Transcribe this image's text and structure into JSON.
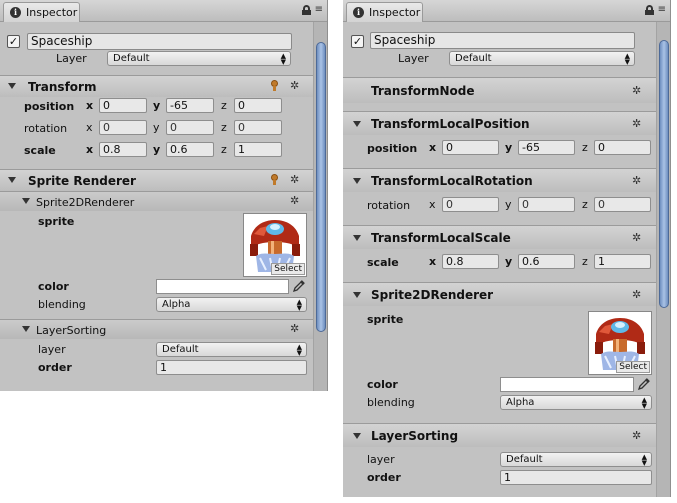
{
  "inspector_tab": "Inspector",
  "gameobject": {
    "name": "Spaceship",
    "active": "✓",
    "layer_label": "Layer",
    "layer_value": "Default"
  },
  "left": {
    "transform": {
      "title": "Transform",
      "position_label": "position",
      "rotation_label": "rotation",
      "scale_label": "scale",
      "x": "x",
      "y": "y",
      "z": "z",
      "position": {
        "x": "0",
        "y": "-65",
        "z": "0"
      },
      "rotation": {
        "x": "0",
        "y": "0",
        "z": "0"
      },
      "scale": {
        "x": "0.8",
        "y": "0.6",
        "z": "1"
      }
    },
    "sprite_renderer": {
      "title": "Sprite Renderer"
    },
    "sprite2d": {
      "title": "Sprite2DRenderer",
      "sprite_label": "sprite",
      "select_label": "Select",
      "color_label": "color",
      "blending_label": "blending",
      "blending_value": "Alpha"
    },
    "layer_sorting": {
      "title": "LayerSorting",
      "layer_label": "layer",
      "layer_value": "Default",
      "order_label": "order",
      "order_value": "1"
    }
  },
  "right": {
    "transform_node": {
      "title": "TransformNode"
    },
    "local_position": {
      "title": "TransformLocalPosition",
      "label": "position",
      "x": "x",
      "y": "y",
      "z": "z",
      "values": {
        "x": "0",
        "y": "-65",
        "z": "0"
      }
    },
    "local_rotation": {
      "title": "TransformLocalRotation",
      "label": "rotation",
      "x": "x",
      "y": "y",
      "z": "z",
      "values": {
        "x": "0",
        "y": "0",
        "z": "0"
      }
    },
    "local_scale": {
      "title": "TransformLocalScale",
      "label": "scale",
      "x": "x",
      "y": "y",
      "z": "z",
      "values": {
        "x": "0.8",
        "y": "0.6",
        "z": "1"
      }
    },
    "sprite2d": {
      "title": "Sprite2DRenderer",
      "sprite_label": "sprite",
      "select_label": "Select",
      "color_label": "color",
      "blending_label": "blending",
      "blending_value": "Alpha"
    },
    "layer_sorting": {
      "title": "LayerSorting",
      "layer_label": "layer",
      "layer_value": "Default",
      "order_label": "order",
      "order_value": "1"
    }
  },
  "icons": {
    "info": "i",
    "lock": "lock-icon",
    "menu": "≡",
    "gear": "✲",
    "foldout": "triangle-down",
    "eyedropper": "eyedropper-icon",
    "dropdown": "▲▼"
  },
  "colors": {
    "panel_bg": "#c2c2c2",
    "scroll_thumb": "#8aa7d4",
    "header_bg": "#c9c9c9"
  }
}
